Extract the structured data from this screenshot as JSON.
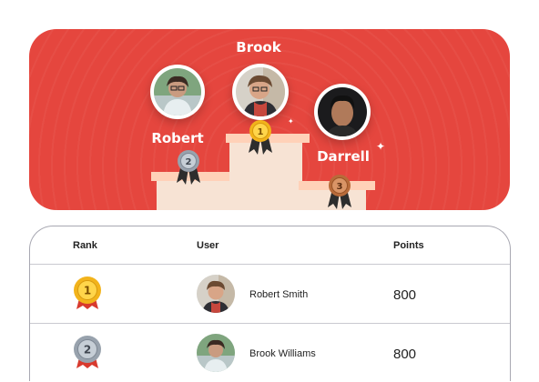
{
  "banner": {
    "first": {
      "name": "Brook",
      "rank": "1"
    },
    "second": {
      "name": "Robert",
      "rank": "2"
    },
    "third": {
      "name": "Darrell",
      "rank": "3"
    }
  },
  "table": {
    "headers": {
      "rank": "Rank",
      "user": "User",
      "points": "Points"
    },
    "rows": [
      {
        "rank": "1",
        "name": "Robert Smith",
        "points": "800"
      },
      {
        "rank": "2",
        "name": "Brook Williams",
        "points": "800"
      }
    ]
  },
  "colors": {
    "banner": "#e5463e",
    "gold": "#f2b31b",
    "silver": "#98a2ad",
    "bronze": "#b86b3a"
  }
}
